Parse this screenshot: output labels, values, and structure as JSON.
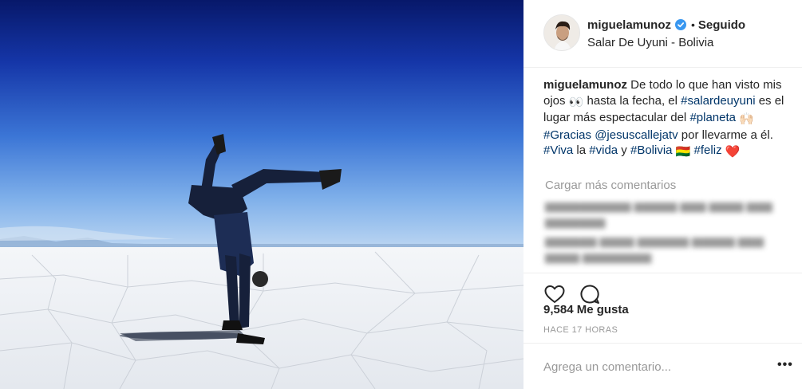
{
  "post": {
    "image_alt": "Person doing a handstand on the Salar de Uyuni salt flat"
  },
  "header": {
    "username": "miguelamunoz",
    "verified_badge": "verified-check-icon",
    "separator": "•",
    "follow_status": "Seguido",
    "location": "Salar De Uyuni - Bolivia"
  },
  "caption": {
    "username": "miguelamunoz",
    "text_1": " De todo lo que han visto mis ojos ",
    "emoji_eyes": "👀",
    "text_2": " hasta la fecha, el ",
    "tag_salar": "#salardeuyuni",
    "text_3": " es el lugar más espectacular del ",
    "tag_planeta": "#planeta",
    "emoji_hands": "🙌🏻",
    "tag_gracias": "#Gracias",
    "mention": "@jesuscallejatv",
    "text_4": " por llevarme a él. ",
    "tag_viva": "#Viva",
    "text_5": " la ",
    "tag_vida": "#vida",
    "text_6": " y ",
    "tag_bolivia": "#Bolivia",
    "emoji_flag": "🇧🇴",
    "tag_feliz": "#feliz",
    "emoji_heart": "❤️"
  },
  "comments": {
    "load_more": "Cargar más comentarios"
  },
  "actions": {
    "like_icon": "heart-icon",
    "comment_icon": "comment-bubble-icon",
    "likes": "9,584 Me gusta",
    "timestamp": "HACE 17 HORAS"
  },
  "add_comment": {
    "placeholder": "Agrega un comentario...",
    "more_label": "•••"
  },
  "colors": {
    "hashtag": "#003569",
    "verified": "#3897f0",
    "muted": "#999999",
    "text": "#262626",
    "sky_top": "#0a1f73",
    "sky_bottom": "#bfd8f2"
  }
}
